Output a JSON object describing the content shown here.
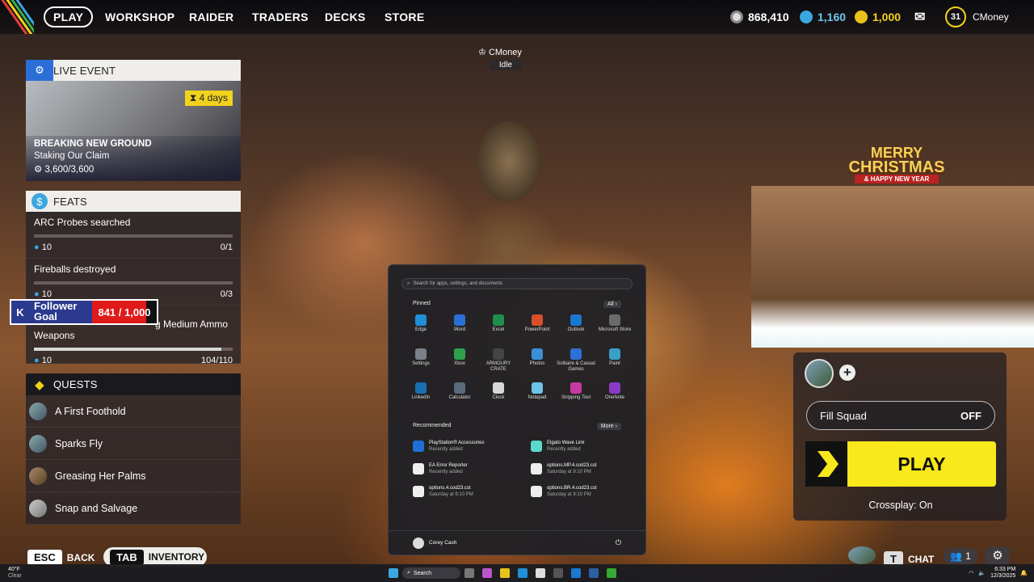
{
  "nav": {
    "items": [
      "PLAY",
      "WORKSHOP",
      "RAIDER",
      "TRADERS",
      "DECKS",
      "STORE"
    ]
  },
  "currency": {
    "coins": "868,410",
    "creds": "1,160",
    "tokens": "1,000"
  },
  "profile": {
    "level": "31",
    "name": "CMoney",
    "floating_name": "CMoney",
    "status": "Idle"
  },
  "live_event": {
    "header": "LIVE EVENT",
    "timer": "4 days",
    "title": "BREAKING NEW GROUND",
    "subtitle": "Staking Our Claim",
    "progress": "3,600/3,600"
  },
  "feats": {
    "header": "FEATS",
    "items": [
      {
        "name": "ARC Probes searched",
        "reward": "10",
        "count": "0/1",
        "fraction": 0
      },
      {
        "name": "Fireballs destroyed",
        "reward": "10",
        "count": "0/3",
        "fraction": 0
      },
      {
        "name": "g Medium Ammo",
        "name2": "Weapons",
        "reward": "10",
        "count": "104/110",
        "fraction": 0.945
      }
    ]
  },
  "follower_goal": {
    "label1": "Follower",
    "label2": "Goal",
    "value": "841 / 1,000",
    "fraction": 0.841
  },
  "quests": {
    "header": "QUESTS",
    "items": [
      "A First Foothold",
      "Sparks Fly",
      "Greasing Her Palms",
      "Snap and Salvage"
    ]
  },
  "start_menu": {
    "search_placeholder": "Search for apps, settings, and documents",
    "pinned_label": "Pinned",
    "all_label": "All",
    "apps": [
      "Edge",
      "Word",
      "Excel",
      "PowerPoint",
      "Outlook",
      "Microsoft Store",
      "Settings",
      "Xbox",
      "ARMOURY CRATE",
      "Photos",
      "Solitaire & Casual Games",
      "Paint",
      "LinkedIn",
      "Calculator",
      "Clock",
      "Notepad",
      "Snipping Tool",
      "OneNote"
    ],
    "app_colors": [
      "#1f8fd8",
      "#2b6fd6",
      "#1d8f4a",
      "#d94f2b",
      "#1a78d0",
      "#6a6a6a",
      "#7a7f88",
      "#2fa14a",
      "#444",
      "#3a8fd6",
      "#2f6fd6",
      "#3aa0c8",
      "#1a6fb0",
      "#5a6a7a",
      "#d8d8d8",
      "#6fc2e8",
      "#c43aa0",
      "#8a3ac2"
    ],
    "recommended_label": "Recommended",
    "more_label": "More",
    "recommended": [
      {
        "name": "PlayStation® Accessories",
        "sub": "Recently added"
      },
      {
        "name": "Elgato Wave Link",
        "sub": "Recently added"
      },
      {
        "name": "EA Error Reporter",
        "sub": "Recently added"
      },
      {
        "name": "options.MP.4.cod23.cst",
        "sub": "Saturday at 9:10 PM"
      },
      {
        "name": "options.4.cod23.cst",
        "sub": "Saturday at 9:10 PM"
      },
      {
        "name": "options.BR.4.cod23.cst",
        "sub": "Saturday at 9:10 PM"
      }
    ],
    "user": "Corey Cash"
  },
  "banner": {
    "line1": "MERRY",
    "line2": "CHRISTMAS",
    "line3": "& HAPPY NEW YEAR"
  },
  "squad": {
    "fill_label": "Fill Squad",
    "fill_value": "OFF",
    "play_label": "PLAY",
    "crossplay": "Crossplay: On"
  },
  "bottom": {
    "esc_key": "ESC",
    "back": "BACK",
    "tab_key": "TAB",
    "inventory": "INVENTORY",
    "chat_key": "T",
    "chat": "CHAT",
    "party_count": "1"
  },
  "taskbar": {
    "weather_temp": "40°F",
    "weather": "Clear",
    "search": "Search",
    "time": "6:33 PM",
    "date": "12/3/2025"
  }
}
